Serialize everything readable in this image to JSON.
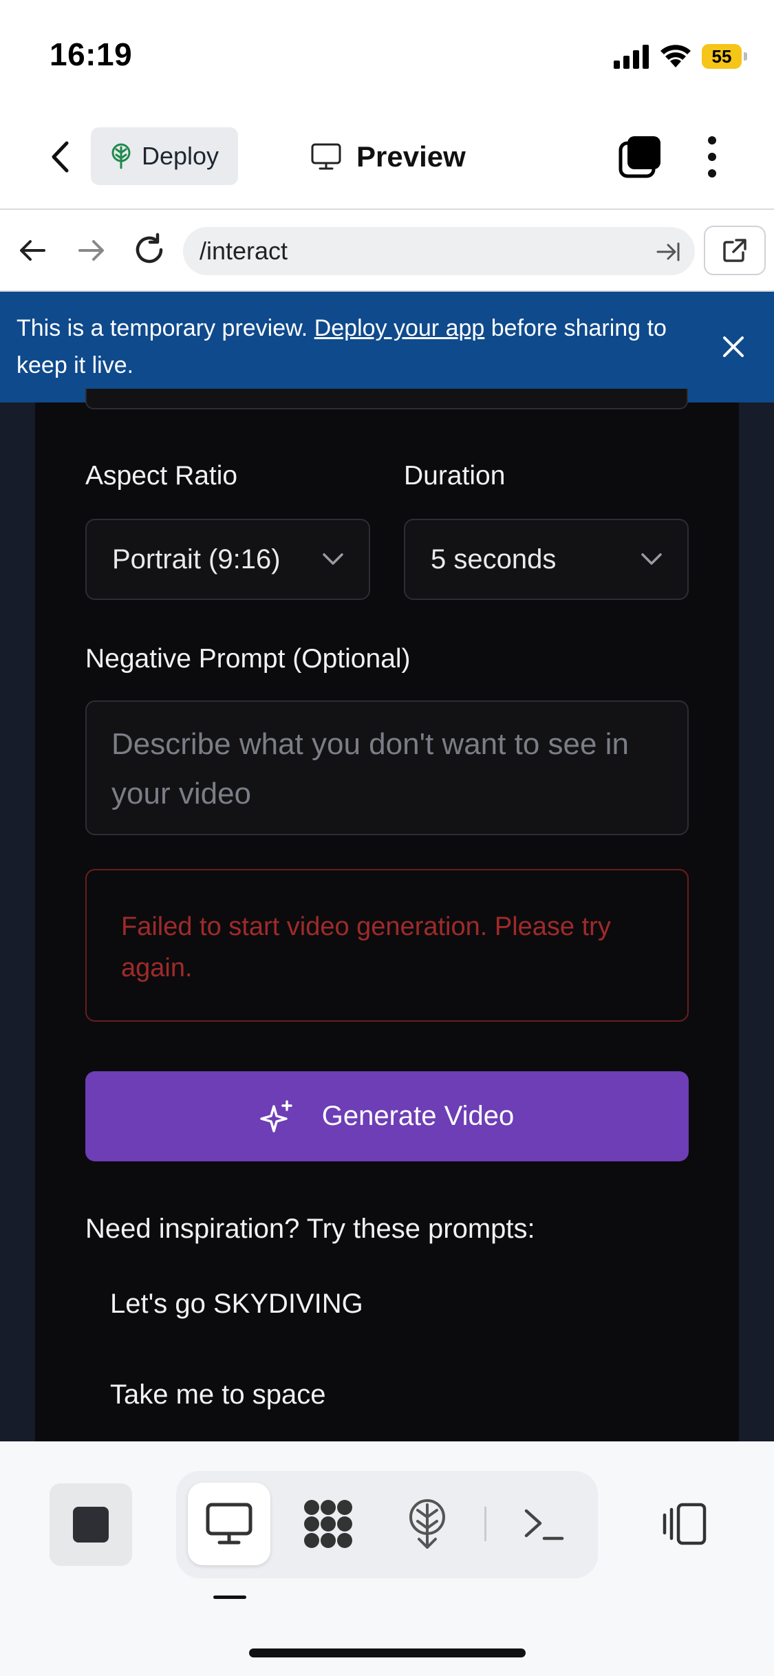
{
  "status_bar": {
    "time": "16:19",
    "battery": "55"
  },
  "top_bar": {
    "deploy_label": "Deploy",
    "preview_label": "Preview"
  },
  "browser": {
    "url": "/interact"
  },
  "banner": {
    "text_before": "This is a temporary preview. ",
    "link_text": "Deploy your app",
    "text_after": " before sharing to keep it live."
  },
  "form": {
    "aspect_ratio_label": "Aspect Ratio",
    "aspect_ratio_value": "Portrait (9:16)",
    "duration_label": "Duration",
    "duration_value": "5 seconds",
    "negative_prompt_label": "Negative Prompt (Optional)",
    "negative_prompt_placeholder": "Describe what you don't want to see in your video",
    "error_message": "Failed to start video generation. Please try again.",
    "generate_label": "Generate Video"
  },
  "inspiration": {
    "title": "Need inspiration? Try these prompts:",
    "prompts": [
      "Let's go SKYDIVING",
      "Take me to space"
    ]
  },
  "colors": {
    "banner": "#0f4a8c",
    "generate_button": "#6d3eb6",
    "error_text": "#a02a2a",
    "battery": "#f5c518"
  },
  "icons": {
    "back": "chevron-left-icon",
    "deploy": "deploy-tree-icon",
    "preview": "monitor-icon",
    "tabs": "tabs-stack-icon",
    "more": "kebab-menu-icon",
    "nav_back": "arrow-left-icon",
    "nav_forward": "arrow-right-icon",
    "reload": "reload-icon",
    "go": "arrow-go-icon",
    "open_external": "external-link-icon",
    "close": "close-icon",
    "sparkle": "sparkle-icon",
    "stop": "stop-icon",
    "desktop": "desktop-icon",
    "integrations": "integrations-icon",
    "deploy_tool": "deploy-icon",
    "console": "terminal-icon",
    "panel": "side-panel-icon"
  }
}
